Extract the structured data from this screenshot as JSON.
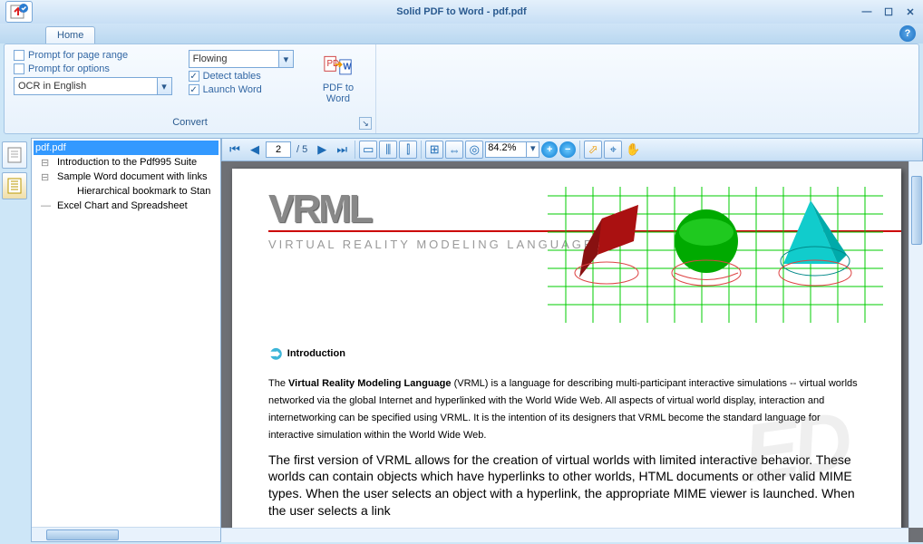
{
  "window": {
    "title": "Solid PDF to Word - pdf.pdf"
  },
  "tabs": {
    "home": "Home"
  },
  "ribbon": {
    "prompt_page_range": "Prompt for page range",
    "prompt_options": "Prompt for options",
    "ocr_combo": "OCR in English",
    "mode_combo": "Flowing",
    "detect_tables": "Detect tables",
    "launch_word": "Launch Word",
    "pdf2word": "PDF to Word",
    "group_label": "Convert"
  },
  "outline": {
    "root": "pdf.pdf",
    "items": [
      "Introduction to the Pdf995 Suite",
      "Sample Word document with links",
      "Hierarchical bookmark to Stan",
      "Excel Chart and Spreadsheet"
    ]
  },
  "pager": {
    "current": "2",
    "total": "/ 5",
    "zoom": "84.2%"
  },
  "doc": {
    "logo_word": "VRML",
    "logo_sub": "VIRTUAL REALITY MODELING LANGUAGE",
    "h2": "Introduction",
    "p1_pre": "The ",
    "p1_bold": "Virtual Reality Modeling Language",
    "p1_post": " (VRML) is a language for describing multi-participant interactive simulations -- virtual worlds networked via the global Internet and hyperlinked with the World Wide Web. All aspects of virtual world display, interaction and internetworking can be specified using VRML. It is the intention of its designers that VRML become the standard language for interactive simulation within the World Wide Web.",
    "p2": "The first version of VRML allows for the creation of virtual worlds with limited interactive behavior. These worlds can contain objects which have hyperlinks to other worlds, HTML documents or other valid MIME types. When the user selects an object with a hyperlink, the appropriate MIME viewer is launched. When the user selects a link"
  }
}
